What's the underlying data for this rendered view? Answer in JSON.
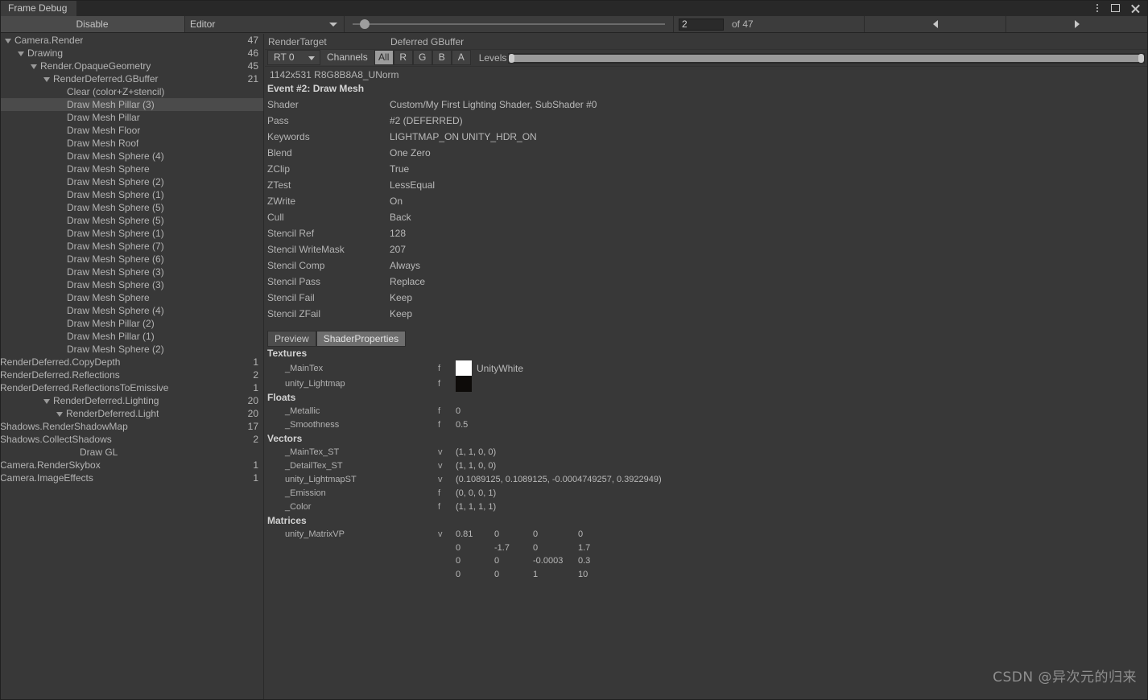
{
  "window": {
    "tab_title": "Frame Debug",
    "menu_icon": "kebab-menu-icon",
    "maximize_icon": "maximize-icon",
    "close_icon": "close-icon"
  },
  "toolbar": {
    "disable_label": "Disable",
    "target_dropdown": "Editor",
    "event_index": "2",
    "event_of_label": "of 47",
    "prev_icon": "triangle-left-icon",
    "next_icon": "triangle-right-icon",
    "slider_value": 2,
    "slider_max": 47
  },
  "rendertarget": {
    "label": "RenderTarget",
    "value": "Deferred GBuffer",
    "rt_select": "RT 0",
    "channels_label": "Channels",
    "channels": [
      "All",
      "R",
      "G",
      "B",
      "A"
    ],
    "channel_selected": "All",
    "levels_label": "Levels",
    "info": "1142x531 R8G8B8A8_UNorm"
  },
  "event": {
    "title": "Event #2: Draw Mesh",
    "properties": [
      {
        "key": "Shader",
        "value": "Custom/My First Lighting Shader, SubShader #0"
      },
      {
        "key": "Pass",
        "value": "#2 (DEFERRED)"
      },
      {
        "key": "Keywords",
        "value": "LIGHTMAP_ON UNITY_HDR_ON"
      },
      {
        "key": "Blend",
        "value": "One Zero"
      },
      {
        "key": "ZClip",
        "value": "True"
      },
      {
        "key": "ZTest",
        "value": "LessEqual"
      },
      {
        "key": "ZWrite",
        "value": "On"
      },
      {
        "key": "Cull",
        "value": "Back"
      },
      {
        "key": "Stencil Ref",
        "value": "128"
      },
      {
        "key": "Stencil WriteMask",
        "value": "207"
      },
      {
        "key": "Stencil Comp",
        "value": "Always"
      },
      {
        "key": "Stencil Pass",
        "value": "Replace"
      },
      {
        "key": "Stencil Fail",
        "value": "Keep"
      },
      {
        "key": "Stencil ZFail",
        "value": "Keep"
      }
    ]
  },
  "detail_tabs": {
    "preview": "Preview",
    "shader_properties": "ShaderProperties",
    "active": "ShaderProperties"
  },
  "shader_properties": {
    "textures_header": "Textures",
    "textures": [
      {
        "name": "_MainTex",
        "type": "f",
        "swatch": "#ffffff",
        "value": "UnityWhite"
      },
      {
        "name": "unity_Lightmap",
        "type": "f",
        "swatch": "#0d0b09",
        "value": ""
      }
    ],
    "floats_header": "Floats",
    "floats": [
      {
        "name": "_Metallic",
        "type": "f",
        "value": "0"
      },
      {
        "name": "_Smoothness",
        "type": "f",
        "value": "0.5"
      }
    ],
    "vectors_header": "Vectors",
    "vectors": [
      {
        "name": "_MainTex_ST",
        "type": "v",
        "value": "(1, 1, 0, 0)"
      },
      {
        "name": "_DetailTex_ST",
        "type": "v",
        "value": "(1, 1, 0, 0)"
      },
      {
        "name": "unity_LightmapST",
        "type": "v",
        "value": "(0.1089125, 0.1089125, -0.0004749257, 0.3922949)"
      },
      {
        "name": "_Emission",
        "type": "f",
        "value": "(0, 0, 0, 1)"
      },
      {
        "name": "_Color",
        "type": "f",
        "value": "(1, 1, 1, 1)"
      }
    ],
    "matrices_header": "Matrices",
    "matrices": [
      {
        "name": "unity_MatrixVP",
        "type": "v",
        "rows": [
          [
            "0.81",
            "0",
            "0",
            "0"
          ],
          [
            "0",
            "-1.7",
            "0",
            "1.7"
          ],
          [
            "0",
            "0",
            "-0.0003",
            "0.3"
          ],
          [
            "0",
            "0",
            "1",
            "10"
          ]
        ]
      }
    ]
  },
  "tree": [
    {
      "label": "Camera.Render",
      "count": "47",
      "depth": 0,
      "toggle": "down"
    },
    {
      "label": "Drawing",
      "count": "46",
      "depth": 1,
      "toggle": "down"
    },
    {
      "label": "Render.OpaqueGeometry",
      "count": "45",
      "depth": 2,
      "toggle": "down"
    },
    {
      "label": "RenderDeferred.GBuffer",
      "count": "21",
      "depth": 3,
      "toggle": "down"
    },
    {
      "label": "Clear (color+Z+stencil)",
      "count": "",
      "depth": 4,
      "toggle": "none"
    },
    {
      "label": "Draw Mesh Pillar (3)",
      "count": "",
      "depth": 4,
      "toggle": "none",
      "selected": true
    },
    {
      "label": "Draw Mesh Pillar",
      "count": "",
      "depth": 4,
      "toggle": "none"
    },
    {
      "label": "Draw Mesh Floor",
      "count": "",
      "depth": 4,
      "toggle": "none"
    },
    {
      "label": "Draw Mesh Roof",
      "count": "",
      "depth": 4,
      "toggle": "none"
    },
    {
      "label": "Draw Mesh Sphere (4)",
      "count": "",
      "depth": 4,
      "toggle": "none"
    },
    {
      "label": "Draw Mesh Sphere",
      "count": "",
      "depth": 4,
      "toggle": "none"
    },
    {
      "label": "Draw Mesh Sphere (2)",
      "count": "",
      "depth": 4,
      "toggle": "none"
    },
    {
      "label": "Draw Mesh Sphere (1)",
      "count": "",
      "depth": 4,
      "toggle": "none"
    },
    {
      "label": "Draw Mesh Sphere (5)",
      "count": "",
      "depth": 4,
      "toggle": "none"
    },
    {
      "label": "Draw Mesh Sphere (5)",
      "count": "",
      "depth": 4,
      "toggle": "none"
    },
    {
      "label": "Draw Mesh Sphere (1)",
      "count": "",
      "depth": 4,
      "toggle": "none"
    },
    {
      "label": "Draw Mesh Sphere (7)",
      "count": "",
      "depth": 4,
      "toggle": "none"
    },
    {
      "label": "Draw Mesh Sphere (6)",
      "count": "",
      "depth": 4,
      "toggle": "none"
    },
    {
      "label": "Draw Mesh Sphere (3)",
      "count": "",
      "depth": 4,
      "toggle": "none"
    },
    {
      "label": "Draw Mesh Sphere (3)",
      "count": "",
      "depth": 4,
      "toggle": "none"
    },
    {
      "label": "Draw Mesh Sphere",
      "count": "",
      "depth": 4,
      "toggle": "none"
    },
    {
      "label": "Draw Mesh Sphere (4)",
      "count": "",
      "depth": 4,
      "toggle": "none"
    },
    {
      "label": "Draw Mesh Pillar (2)",
      "count": "",
      "depth": 4,
      "toggle": "none"
    },
    {
      "label": "Draw Mesh Pillar (1)",
      "count": "",
      "depth": 4,
      "toggle": "none"
    },
    {
      "label": "Draw Mesh Sphere (2)",
      "count": "",
      "depth": 4,
      "toggle": "none"
    },
    {
      "label": "RenderDeferred.CopyDepth",
      "count": "1",
      "depth": 3,
      "toggle": "right"
    },
    {
      "label": "RenderDeferred.Reflections",
      "count": "2",
      "depth": 3,
      "toggle": "right"
    },
    {
      "label": "RenderDeferred.ReflectionsToEmissive",
      "count": "1",
      "depth": 3,
      "toggle": "right"
    },
    {
      "label": "RenderDeferred.Lighting",
      "count": "20",
      "depth": 3,
      "toggle": "down"
    },
    {
      "label": "RenderDeferred.Light",
      "count": "20",
      "depth": 4,
      "toggle": "down"
    },
    {
      "label": "Shadows.RenderShadowMap",
      "count": "17",
      "depth": 5,
      "toggle": "right"
    },
    {
      "label": "Shadows.CollectShadows",
      "count": "2",
      "depth": 5,
      "toggle": "right"
    },
    {
      "label": "Draw GL",
      "count": "",
      "depth": 5,
      "toggle": "none"
    },
    {
      "label": "Camera.RenderSkybox",
      "count": "1",
      "depth": 2,
      "toggle": "right"
    },
    {
      "label": "Camera.ImageEffects",
      "count": "1",
      "depth": 1,
      "toggle": "right"
    }
  ],
  "watermark": "CSDN @异次元的归来"
}
